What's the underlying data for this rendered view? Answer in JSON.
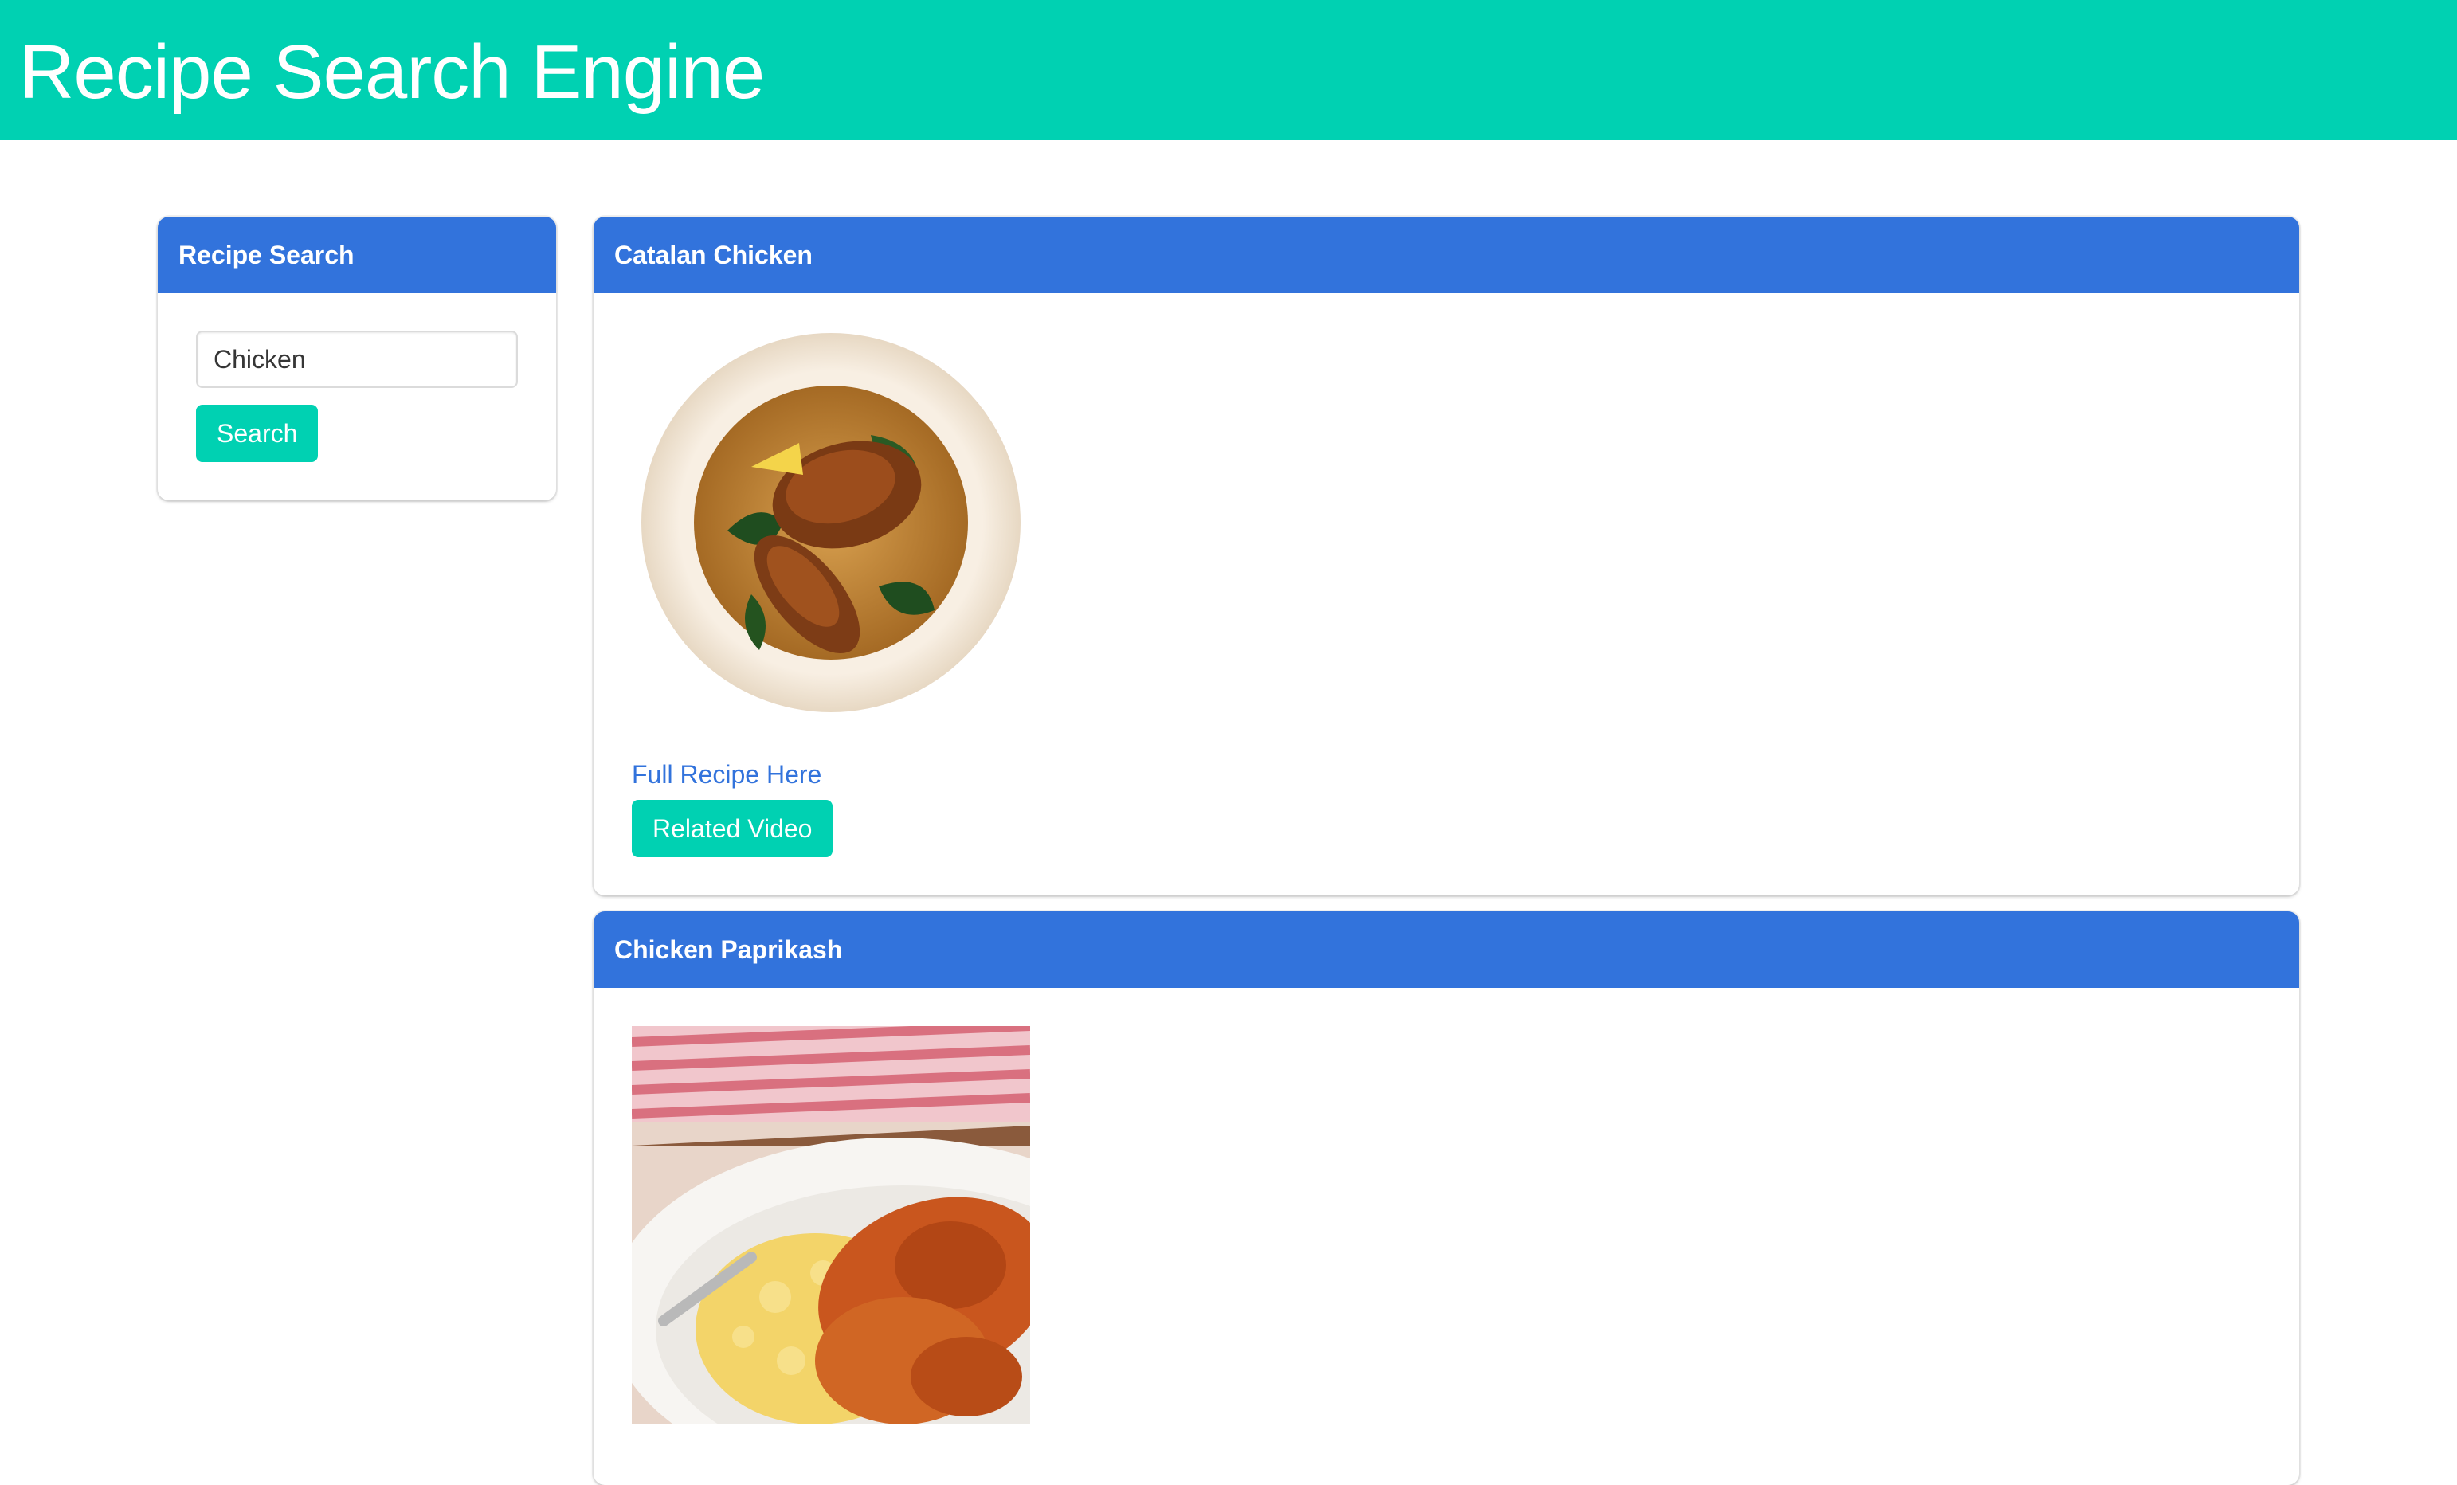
{
  "header": {
    "title": "Recipe Search Engine",
    "background_color": "#00d1b2"
  },
  "search_panel": {
    "title": "Recipe Search",
    "input_value": "Chicken",
    "button_label": "Search"
  },
  "recipes": [
    {
      "title": "Catalan Chicken",
      "image": "plated-chicken-with-greens-photo",
      "link_label": "Full Recipe Here",
      "video_button_label": "Related Video"
    },
    {
      "title": "Chicken Paprikash",
      "image": "chicken-paprikash-with-spaetzle-photo"
    }
  ],
  "colors": {
    "primary": "#00d1b2",
    "link": "#3273dc",
    "panel_header": "#3273dc"
  }
}
